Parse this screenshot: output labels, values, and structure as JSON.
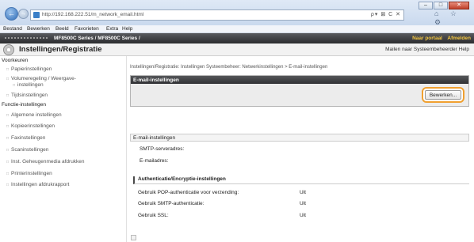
{
  "window": {
    "url": "http://192.168.222.51/m_network_email.html",
    "address_tools": "ρ▾ ⊠ C ✕",
    "toolbar_icons": "⌂ ☆ ⚙"
  },
  "menu": {
    "file": "Bestand",
    "edit": "Bewerken",
    "view": "Beeld",
    "favorites": "Favorieten",
    "extra": "Extra",
    "help": "Help"
  },
  "product_bar": {
    "product": "MF8500C Series / MF8500C Series /",
    "portal": "Naar portaal",
    "logout": "Afmelden"
  },
  "header": {
    "title": "Instellingen/Registratie",
    "right_links": "Mailen naar Systeembeheerder  Help"
  },
  "sidebar": {
    "preferences": "Voorkeuren",
    "items1": [
      "Papierinstellingen",
      "Volumeregeling / Weergave-",
      "instellingen",
      "Tijdsinstellingen"
    ],
    "functions": "Functie-instellingen",
    "items2": [
      "Algemene instellingen",
      "Kopieerinstellingen",
      "Faxinstellingen",
      "Scaninstellingen",
      "Inst. Geheugenmedia afdrukken",
      "Printerinstellingen",
      "Instellingen afdrukrapport"
    ]
  },
  "main": {
    "breadcrumb": "Instellingen/Registratie: Instellingen Systeembeheer: Netwerkinstellingen > E-mail-instellingen",
    "panel_title": "E-mail-instellingen",
    "edit_button": "Bewerken...",
    "section_title": "E-mail-instellingen",
    "smtp_label": "SMTP-serveradres:",
    "email_label": "E-mailadres:",
    "auth_title": "Authenticatie/Encryptie-instellingen",
    "rows": [
      {
        "label": "Gebruik POP-authenticatie voor verzending:",
        "value": "Uit"
      },
      {
        "label": "Gebruik SMTP-authenticatie:",
        "value": "Uit"
      },
      {
        "label": "Gebruik SSL:",
        "value": "Uit"
      }
    ]
  },
  "colors": {
    "accent_highlight": "#f0a030",
    "portal_link": "#f5c842",
    "panel_header": "#303134"
  }
}
